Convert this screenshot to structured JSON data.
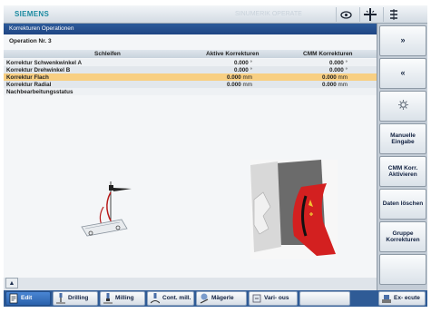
{
  "topbar": {
    "brand": "SIEMENS",
    "faded_title": "SINUMERIK OPERATE",
    "icons": [
      "camera-icon",
      "crosshair-icon",
      "menu-icon"
    ]
  },
  "title": "Korrekturen Operationen",
  "operation_label": "Operation Nr. 3",
  "table": {
    "headers": [
      "Schleifen",
      "Aktive Korrekturen",
      "CMM Korrekturen"
    ],
    "rows": [
      {
        "name": "Korrektur Schwenkwinkel A",
        "active": "0.000",
        "active_unit": "°",
        "cmm": "0.000",
        "cmm_unit": "°"
      },
      {
        "name": "Korrektur Drehwinkel B",
        "active": "0.000",
        "active_unit": "°",
        "cmm": "0.000",
        "cmm_unit": "°"
      },
      {
        "name": "Korrektur Flach",
        "active": "0.000",
        "active_unit": "mm",
        "cmm": "0.000",
        "cmm_unit": "mm"
      },
      {
        "name": "Korrektur Radial",
        "active": "0.000",
        "active_unit": "mm",
        "cmm": "0.000",
        "cmm_unit": "mm"
      },
      {
        "name": "Nachbearbeitungsstatus",
        "active": "",
        "active_unit": "",
        "cmm": "",
        "cmm_unit": ""
      }
    ],
    "selected_row": 2
  },
  "softkeys_right": {
    "k1": "»",
    "k3": "«",
    "k4_icon": "gear-icon",
    "k5": "Manuelle Eingabe",
    "k6": "CMM Korr. Aktivieren",
    "k7": "Daten löschen",
    "k8": "Gruppe Korrekturen"
  },
  "softkeys_bottom": {
    "edit": "Edit",
    "drilling": "Drilling",
    "milling": "Milling",
    "contour": "Cont. mill.",
    "magerle": "Mägerle",
    "various": "Vari- ous",
    "execute": "Ex- ecute"
  },
  "colors": {
    "title_bar": "#1f4684",
    "selected_row": "#f8cf82",
    "bottom_bar": "#2f5b96",
    "brand": "#1b8aa0"
  }
}
